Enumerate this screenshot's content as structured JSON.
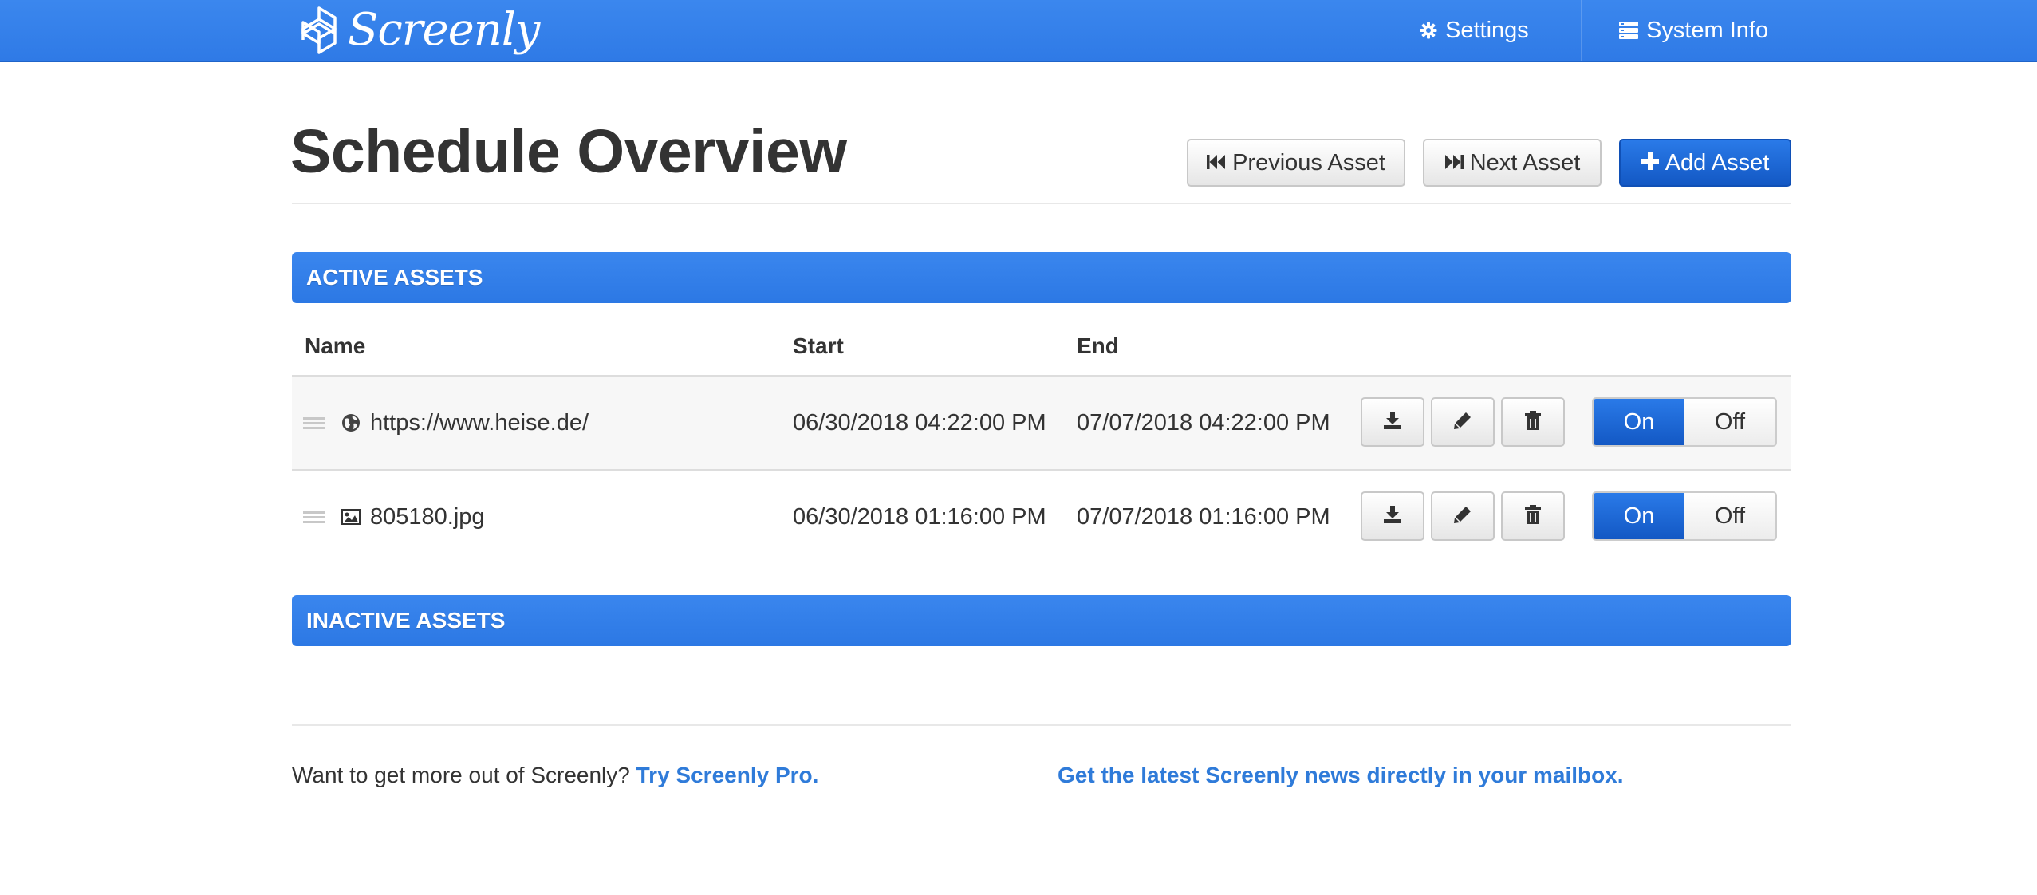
{
  "brand": {
    "name": "Screenly"
  },
  "nav": {
    "settings_label": "Settings",
    "system_info_label": "System Info"
  },
  "header": {
    "title": "Schedule Overview",
    "buttons": {
      "previous": "Previous Asset",
      "next": "Next Asset",
      "add": "Add Asset"
    }
  },
  "sections": {
    "active": "ACTIVE ASSETS",
    "inactive": "INACTIVE ASSETS"
  },
  "table": {
    "columns": [
      "Name",
      "Start",
      "End"
    ],
    "rows": [
      {
        "icon": "globe-icon",
        "name": "https://www.heise.de/",
        "start": "06/30/2018 04:22:00 PM",
        "end": "07/07/2018 04:22:00 PM",
        "on_label": "On",
        "off_label": "Off",
        "state": "on"
      },
      {
        "icon": "image-icon",
        "name": "805180.jpg",
        "start": "06/30/2018 01:16:00 PM",
        "end": "07/07/2018 01:16:00 PM",
        "on_label": "On",
        "off_label": "Off",
        "state": "on"
      }
    ]
  },
  "footer": {
    "question": "Want to get more out of Screenly?",
    "pro_link": "Try Screenly Pro.",
    "news_link": "Get the latest Screenly news directly in your mailbox."
  },
  "colors": {
    "navbar": "#3b87ee",
    "primary_button": "#1a63d0",
    "link": "#2f7bd9"
  }
}
